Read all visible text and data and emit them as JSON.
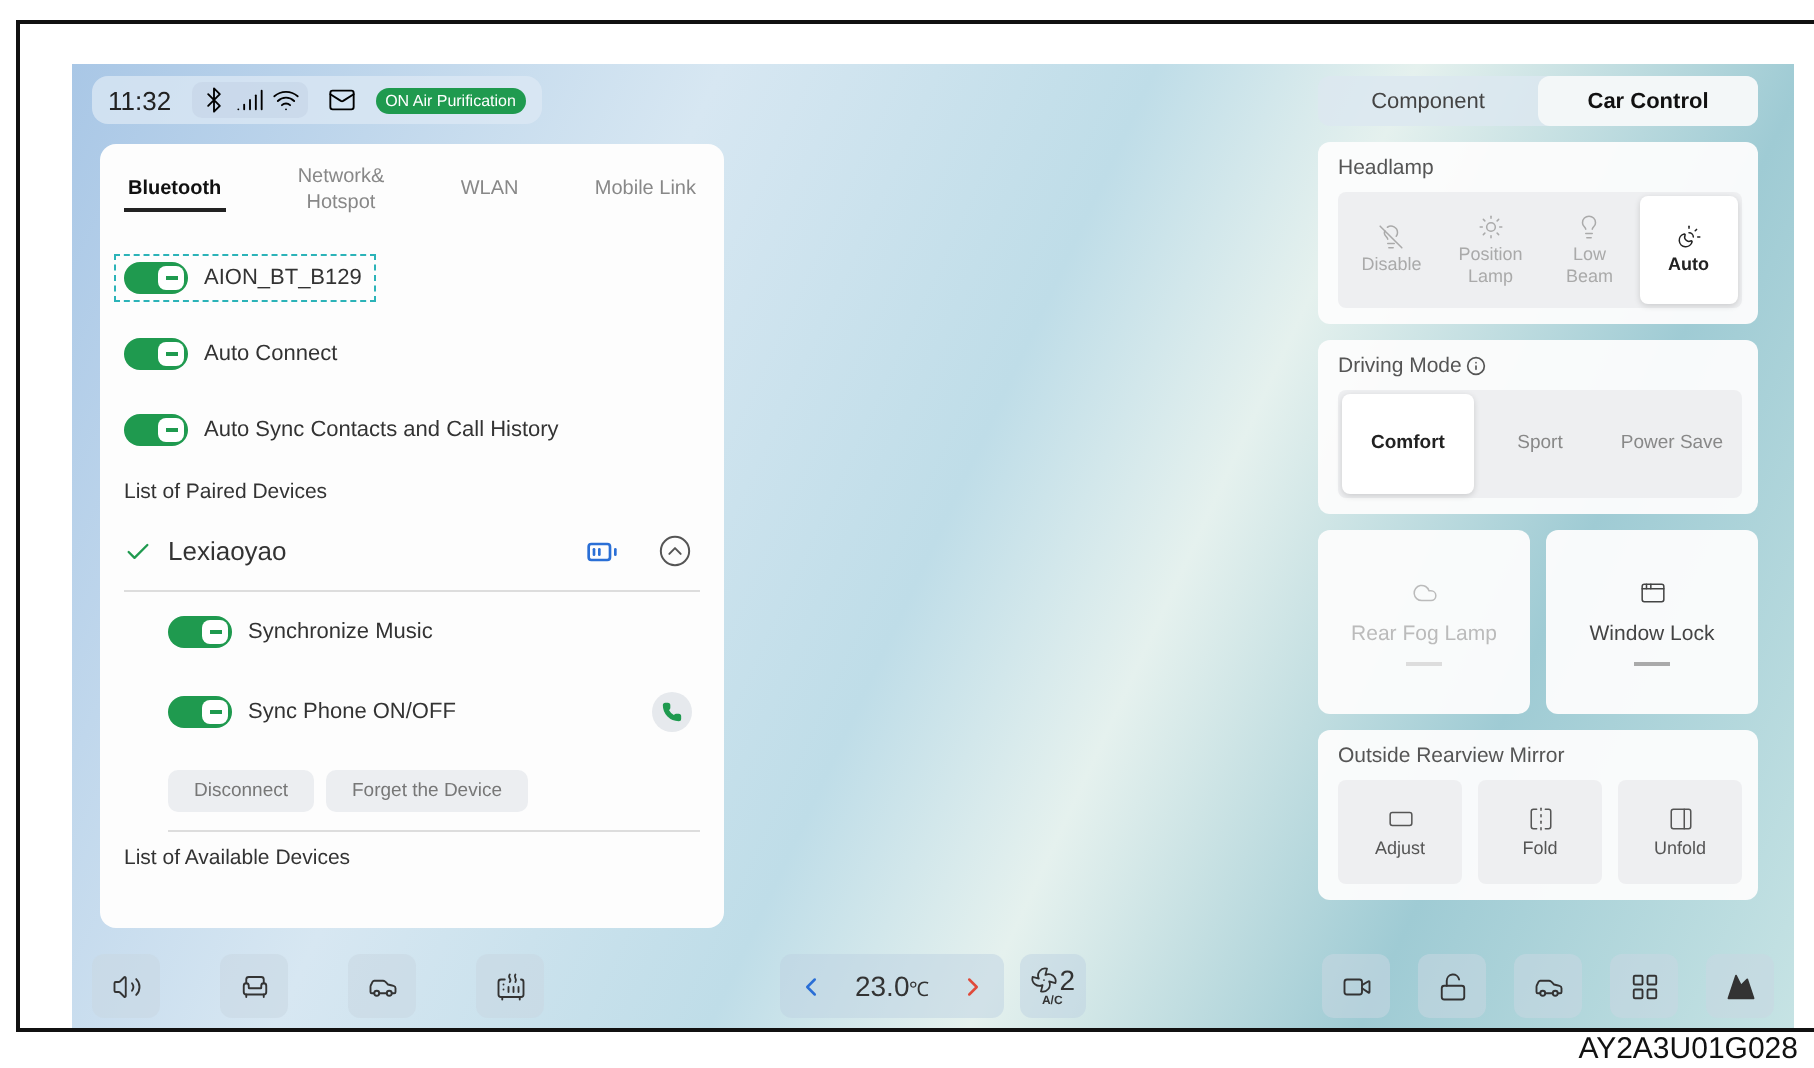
{
  "status_bar": {
    "time": "11:32",
    "badge": {
      "label": "ON Air Purification",
      "on": true
    }
  },
  "connection_panel": {
    "tabs": [
      {
        "label": "Bluetooth",
        "selected": true
      },
      {
        "label": "Network&\nHotspot",
        "selected": false
      },
      {
        "label": "WLAN",
        "selected": false
      },
      {
        "label": "Mobile Link",
        "selected": false
      }
    ],
    "toggles": [
      {
        "label": "AION_BT_B129",
        "on": true,
        "highlighted": true
      },
      {
        "label": "Auto Connect",
        "on": true,
        "highlighted": false
      },
      {
        "label": "Auto Sync Contacts and Call History",
        "on": true,
        "highlighted": false
      }
    ],
    "paired_heading": "List of Paired Devices",
    "device": {
      "name": "Lexiaoyao",
      "connected": true,
      "expanded": true,
      "toggles": [
        {
          "label": "Synchronize Music",
          "on": true
        },
        {
          "label": "Sync Phone ON/OFF",
          "on": true
        }
      ],
      "buttons": [
        "Disconnect",
        "Forget the Device"
      ]
    },
    "available_heading": "List of Available Devices"
  },
  "control_panel": {
    "tabs": [
      {
        "label": "Component",
        "selected": false
      },
      {
        "label": "Car Control",
        "selected": true
      }
    ],
    "headlamp": {
      "title": "Headlamp",
      "options": [
        {
          "label": "Disable",
          "selected": false
        },
        {
          "label": "Position\nLamp",
          "selected": false
        },
        {
          "label": "Low\nBeam",
          "selected": false
        },
        {
          "label": "Auto",
          "selected": true
        }
      ]
    },
    "driving_mode": {
      "title": "Driving Mode",
      "options": [
        {
          "label": "Comfort",
          "selected": true
        },
        {
          "label": "Sport",
          "selected": false
        },
        {
          "label": "Power Save",
          "selected": false
        }
      ]
    },
    "tiles": [
      {
        "label": "Rear Fog Lamp",
        "on": false
      },
      {
        "label": "Window Lock",
        "on": true
      }
    ],
    "mirror": {
      "title": "Outside Rearview Mirror",
      "buttons": [
        "Adjust",
        "Fold",
        "Unfold"
      ]
    }
  },
  "dock": {
    "temperature": "23.0",
    "unit": "℃",
    "fan_speed": "2",
    "fan_mode": "A/C"
  },
  "caption": "AY2A3U01G028"
}
